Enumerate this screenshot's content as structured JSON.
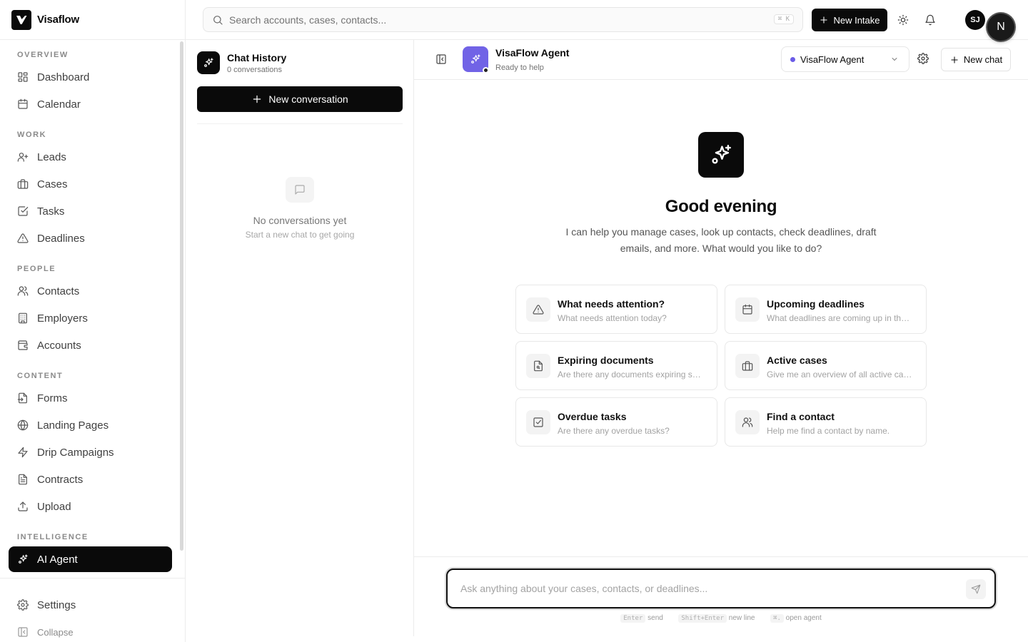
{
  "app": {
    "name": "Visaflow"
  },
  "sidebar": {
    "sections": {
      "overview": "OVERVIEW",
      "work": "WORK",
      "people": "PEOPLE",
      "content": "CONTENT",
      "intelligence": "INTELLIGENCE"
    },
    "items": [
      {
        "label": "Dashboard",
        "icon": "dashboard-icon"
      },
      {
        "label": "Calendar",
        "icon": "calendar-icon"
      },
      {
        "label": "Leads",
        "icon": "user-plus-icon"
      },
      {
        "label": "Cases",
        "icon": "briefcase-icon"
      },
      {
        "label": "Tasks",
        "icon": "checkbox-icon"
      },
      {
        "label": "Deadlines",
        "icon": "warning-icon"
      },
      {
        "label": "Contacts",
        "icon": "users-icon"
      },
      {
        "label": "Employers",
        "icon": "building-icon"
      },
      {
        "label": "Accounts",
        "icon": "wallet-icon"
      },
      {
        "label": "Forms",
        "icon": "form-icon"
      },
      {
        "label": "Landing Pages",
        "icon": "globe-icon"
      },
      {
        "label": "Drip Campaigns",
        "icon": "lightning-icon"
      },
      {
        "label": "Contracts",
        "icon": "document-icon"
      },
      {
        "label": "Upload",
        "icon": "upload-icon"
      },
      {
        "label": "AI Agent",
        "icon": "sparkles-icon",
        "active": true
      }
    ],
    "settings_label": "Settings",
    "collapse_label": "Collapse"
  },
  "topbar": {
    "search_placeholder": "Search accounts, cases, contacts...",
    "search_shortcut": "⌘ K",
    "new_intake_label": "New Intake",
    "user_initials": "SJ",
    "floating_avatar": "N"
  },
  "history": {
    "title": "Chat History",
    "count": "0 conversations",
    "new_conversation_label": "New conversation",
    "empty_title": "No conversations yet",
    "empty_subtitle": "Start a new chat to get going"
  },
  "chat": {
    "agent_name": "VisaFlow Agent",
    "agent_status": "Ready to help",
    "agent_select": "VisaFlow Agent",
    "new_chat_label": "New chat",
    "greeting": "Good evening",
    "intro": "I can help you manage cases, look up contacts, check deadlines, draft emails, and more. What would you like to do?",
    "suggestions": [
      {
        "title": "What needs attention?",
        "desc": "What needs attention today?",
        "icon": "warning-icon"
      },
      {
        "title": "Upcoming deadlines",
        "desc": "What deadlines are coming up in the next two weeks?",
        "icon": "calendar-icon"
      },
      {
        "title": "Expiring documents",
        "desc": "Are there any documents expiring soon?",
        "icon": "file-search-icon"
      },
      {
        "title": "Active cases",
        "desc": "Give me an overview of all active cases",
        "icon": "briefcase-icon"
      },
      {
        "title": "Overdue tasks",
        "desc": "Are there any overdue tasks?",
        "icon": "checkbox-icon"
      },
      {
        "title": "Find a contact",
        "desc": "Help me find a contact by name.",
        "icon": "users-icon"
      }
    ],
    "input_placeholder": "Ask anything about your cases, contacts, or deadlines...",
    "hints": {
      "enter_key": "Enter",
      "enter_text": "send",
      "shift_key": "Shift+Enter",
      "shift_text": "new line",
      "agent_key": "⌘.",
      "agent_text": "open agent"
    }
  },
  "colors": {
    "accent": "#0a0a0a",
    "agent_avatar": "#7163e6",
    "agent_dot": "#6b5ce7"
  }
}
